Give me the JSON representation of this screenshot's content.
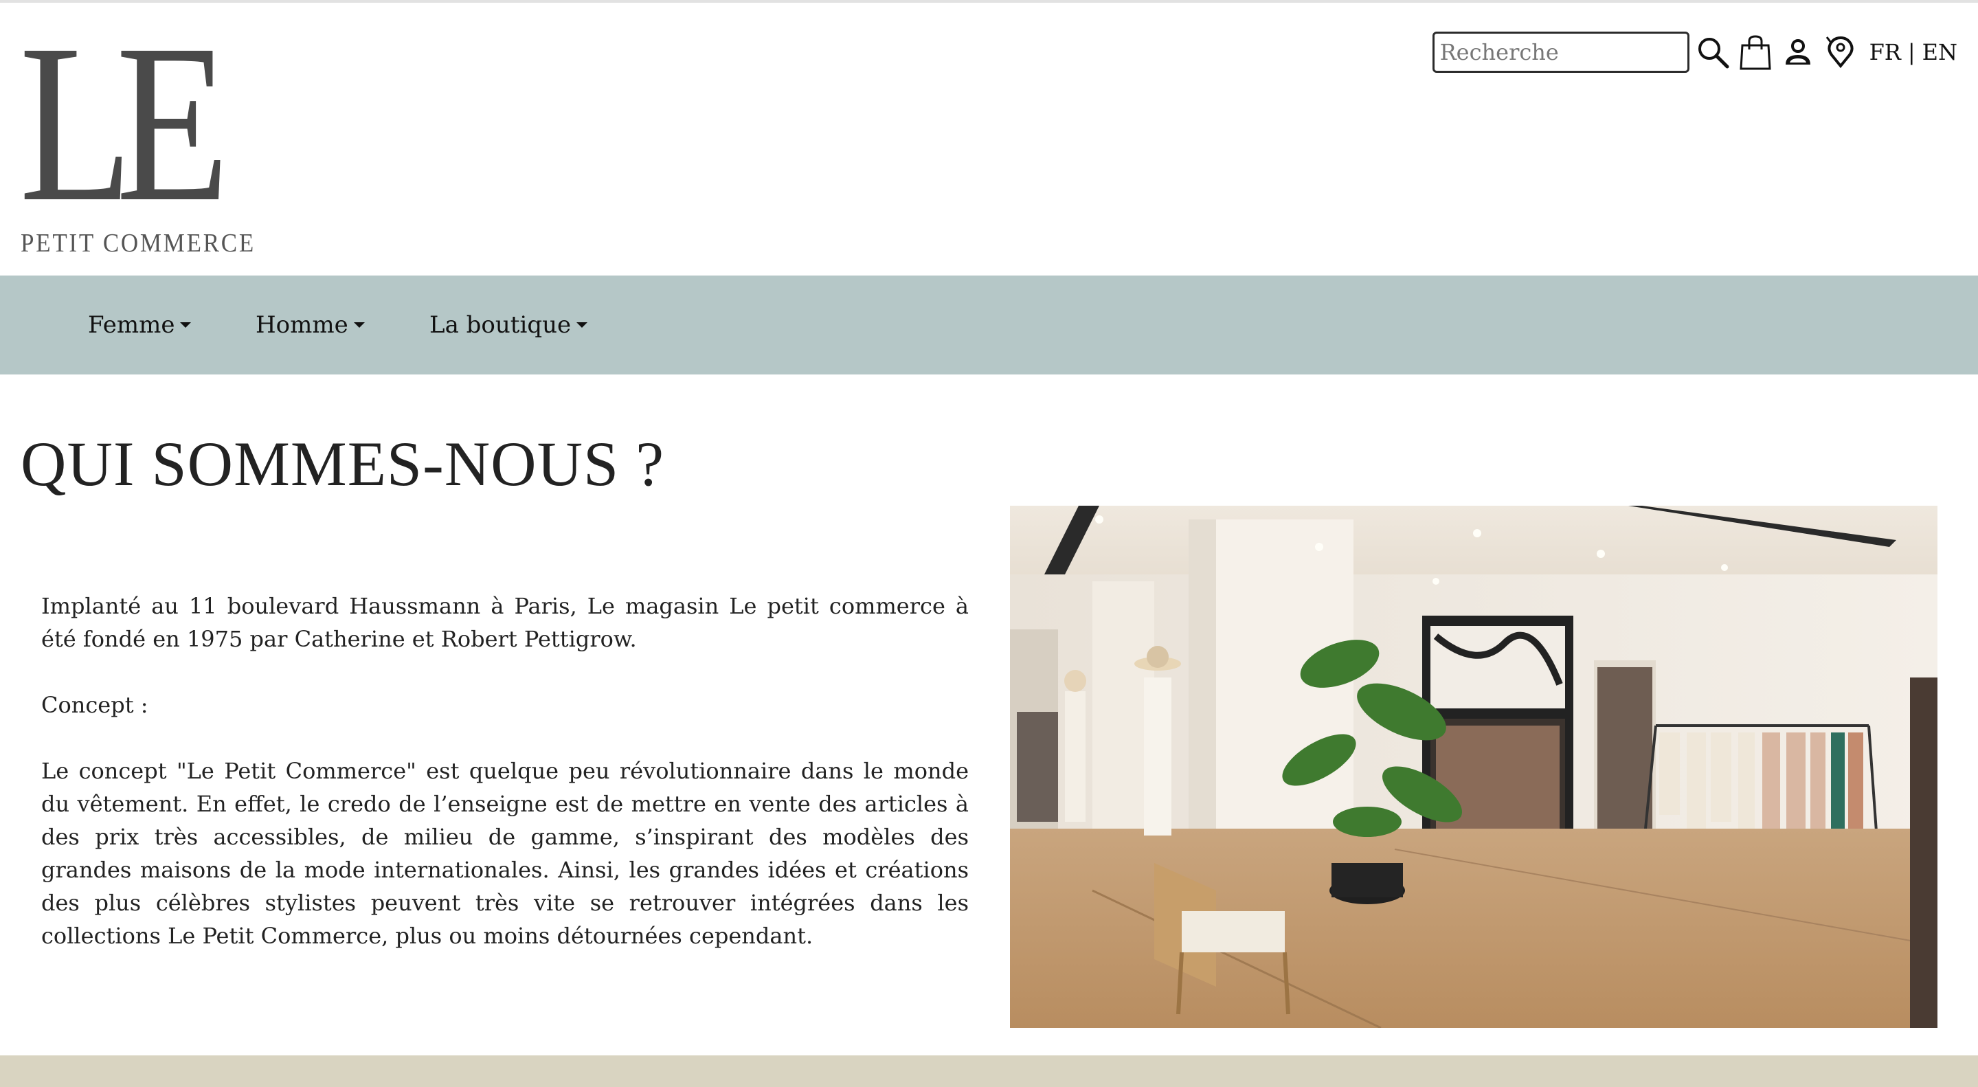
{
  "brand": {
    "logo_main": "LE",
    "logo_sub": "PETIT COMMERCE"
  },
  "header": {
    "search_placeholder": "Recherche",
    "icons": [
      "search-icon",
      "shopping-bag-icon",
      "user-icon",
      "location-pin-icon"
    ],
    "lang_fr": "FR",
    "lang_sep": "|",
    "lang_en": "EN"
  },
  "nav": {
    "items": [
      {
        "label": "Femme"
      },
      {
        "label": "Homme"
      },
      {
        "label": "La boutique"
      }
    ]
  },
  "main": {
    "title": "QUI SOMMES-NOUS ?",
    "paragraphs": [
      "Implanté au 11 boulevard Haussmann à Paris, Le magasin Le petit commerce à été fondé en 1975 par Catherine et Robert Pettigrow.",
      "Concept :",
      "Le concept \"Le Petit Commerce\" est quelque peu révolutionnaire dans le monde du vêtement. En effet, le credo de l’enseigne est de mettre en vente des articles à des prix très accessibles, de milieu de gamme, s’inspirant des modèles des grandes maisons de la mode internationales. Ainsi, les grandes idées et créations des plus célèbres stylistes peuvent très vite se retrouver intégrées dans les collections Le Petit Commerce, plus ou moins détournées cependant."
    ]
  },
  "colors": {
    "nav_bg": "#b5c7c7",
    "footer_bg": "#d9d4c1",
    "text": "#222222"
  }
}
